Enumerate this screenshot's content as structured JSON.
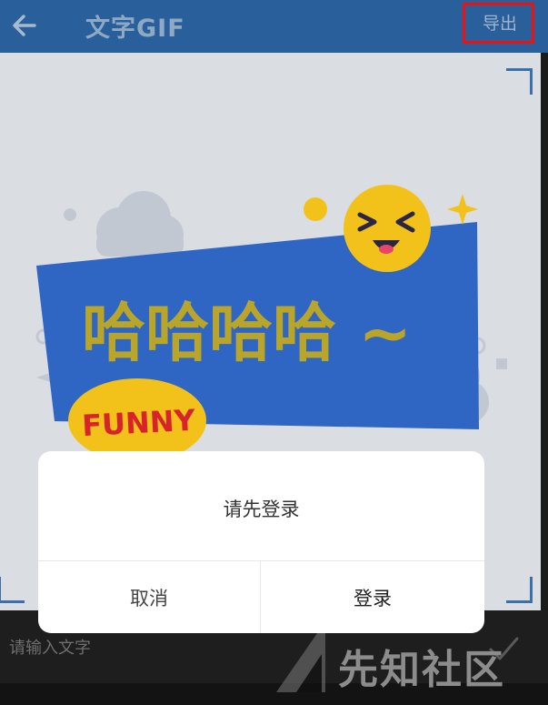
{
  "header": {
    "title": "文字GIF",
    "export_label": "导出",
    "back_icon": "arrow-left-icon",
    "background": "#29609b"
  },
  "preview": {
    "main_text": "哈哈哈哈 ~",
    "badge_text": "FUNNY",
    "colors": {
      "banner": "#2f66c4",
      "text": "#b8a52a",
      "emoji": "#f2c21b",
      "badge": "#f2c21b",
      "badge_text": "#d8232a"
    }
  },
  "input": {
    "placeholder": "请输入文字",
    "confirm_icon": "checkmark-icon"
  },
  "dialog": {
    "message": "请先登录",
    "cancel_label": "取消",
    "login_label": "登录"
  },
  "watermark": {
    "text": "先知社区"
  }
}
